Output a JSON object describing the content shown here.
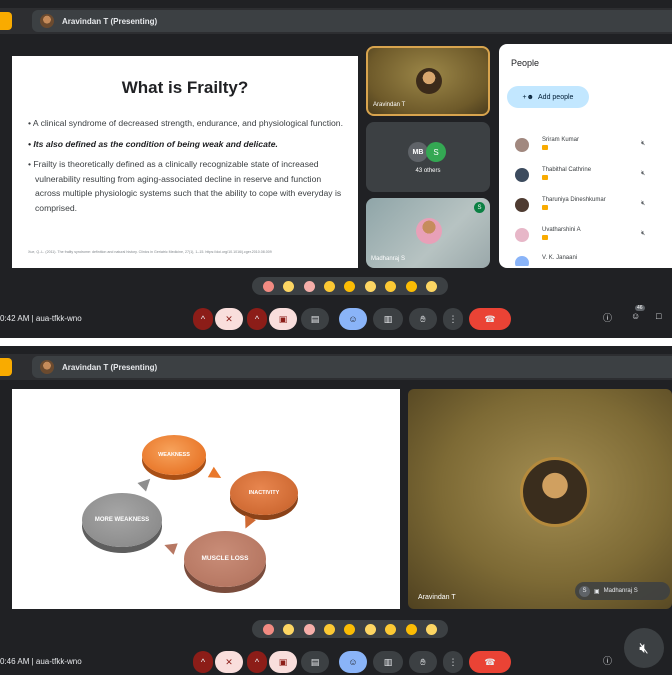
{
  "colors": {
    "bg": "#202124",
    "accent_red": "#ea4335",
    "accent_blue": "#8ab4f8",
    "highlight": "#f9ab00"
  },
  "shot1": {
    "presenter": "Aravindan T (Presenting)",
    "slide": {
      "title": "What is Frailty?",
      "bullets": [
        "• A clinical syndrome of decreased strength, endurance, and physiological function.",
        "• Its also defined as the condition of being weak and delicate.",
        "• Frailty is theoretically defined as a clinically recognizable state of increased vulnerability resulting from aging-associated decline in reserve and function across multiple physiologic systems such that the ability to cope with everyday is comprised."
      ],
      "reference": "Xue, Q.-L. (2011). The frailty syndrome: definition and natural history. Clinics in Geriatric Medicine, 27(1), 1–15. https://doi.org/10.1016/j.cger.2010.08.009"
    },
    "tiles": {
      "presenter_name": "Aravindan T",
      "others_label": "43 others",
      "others_initials": [
        "MB",
        "S"
      ],
      "madhanraj_name": "Madhanraj S",
      "madhanraj_badge": "S"
    },
    "people_panel": {
      "title": "People",
      "add_label": "Add people",
      "people": [
        {
          "name": "Sriram Kumar"
        },
        {
          "name": "Thabithal Cathrine"
        },
        {
          "name": "Tharuniya Dineshkumar"
        },
        {
          "name": "Uvatharshini A"
        },
        {
          "name": "V. K. Janaani"
        }
      ]
    },
    "controls": {
      "time": "0:42 AM  |  aua-tfkk-wno",
      "people_count": "46"
    }
  },
  "shot2": {
    "presenter": "Aravindan T (Presenting)",
    "diagram": {
      "nodes": [
        "WEAKNESS",
        "INACTIVITY",
        "MUSCLE LOSS",
        "MORE WEAKNESS"
      ]
    },
    "tile_name": "Aravindan T",
    "pip_initial": "S",
    "pip_name": "Madhanraj S",
    "controls": {
      "time": "0:46 AM  |  aua-tfkk-wno"
    }
  }
}
